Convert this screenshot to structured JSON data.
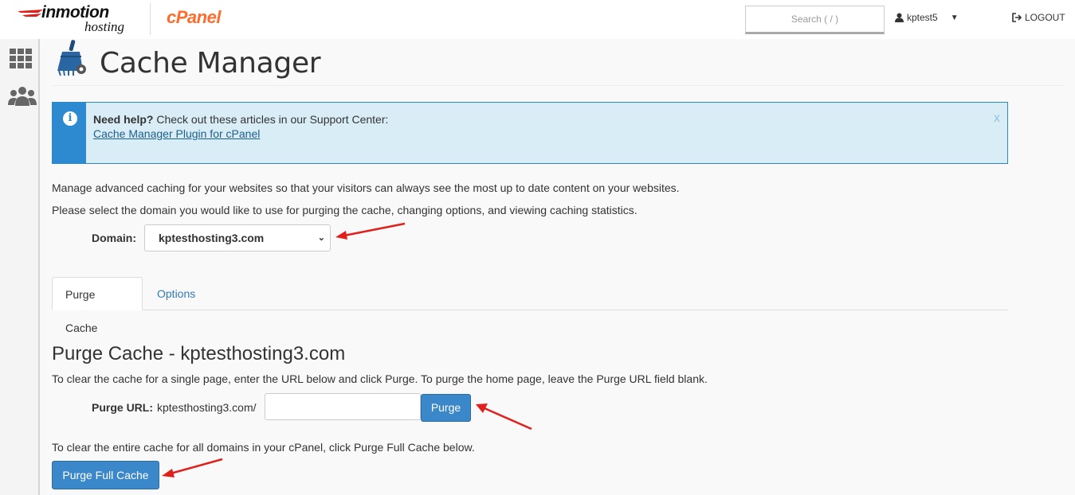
{
  "header": {
    "brand_top": "inmotion",
    "brand_bottom": "hosting",
    "cpanel": "cPanel",
    "search_placeholder": "Search ( / )",
    "username": "kptest5",
    "logout": "LOGOUT"
  },
  "page": {
    "title": "Cache Manager"
  },
  "alert": {
    "lead": "Need help?",
    "text": " Check out these articles in our Support Center:",
    "link": "Cache Manager Plugin for cPanel",
    "close": "x"
  },
  "intro": {
    "line1": "Manage advanced caching for your websites so that your visitors can always see the most up to date content on your websites.",
    "line2": "Please select the domain you would like to use for purging the cache, changing options, and viewing caching statistics."
  },
  "domain": {
    "label": "Domain:",
    "selected": "kptesthosting3.com"
  },
  "tabs": [
    {
      "label": "Purge Cache",
      "active": true
    },
    {
      "label": "Options",
      "active": false
    }
  ],
  "purge": {
    "heading": "Purge Cache - kptesthosting3.com",
    "instructions": "To clear the cache for a single page, enter the URL below and click Purge. To purge the home page, leave the Purge URL field blank.",
    "url_label": "Purge URL:",
    "url_prefix": "kptesthosting3.com/",
    "url_value": "",
    "button": "Purge",
    "full_instructions": "To clear the entire cache for all domains in your cPanel, click Purge Full Cache below.",
    "full_button": "Purge Full Cache"
  },
  "colors": {
    "accent": "#3a87c9",
    "cpanel_orange": "#ff6c2c",
    "alert_bg": "#d9edf7",
    "annotation_arrow": "#e0201c"
  }
}
